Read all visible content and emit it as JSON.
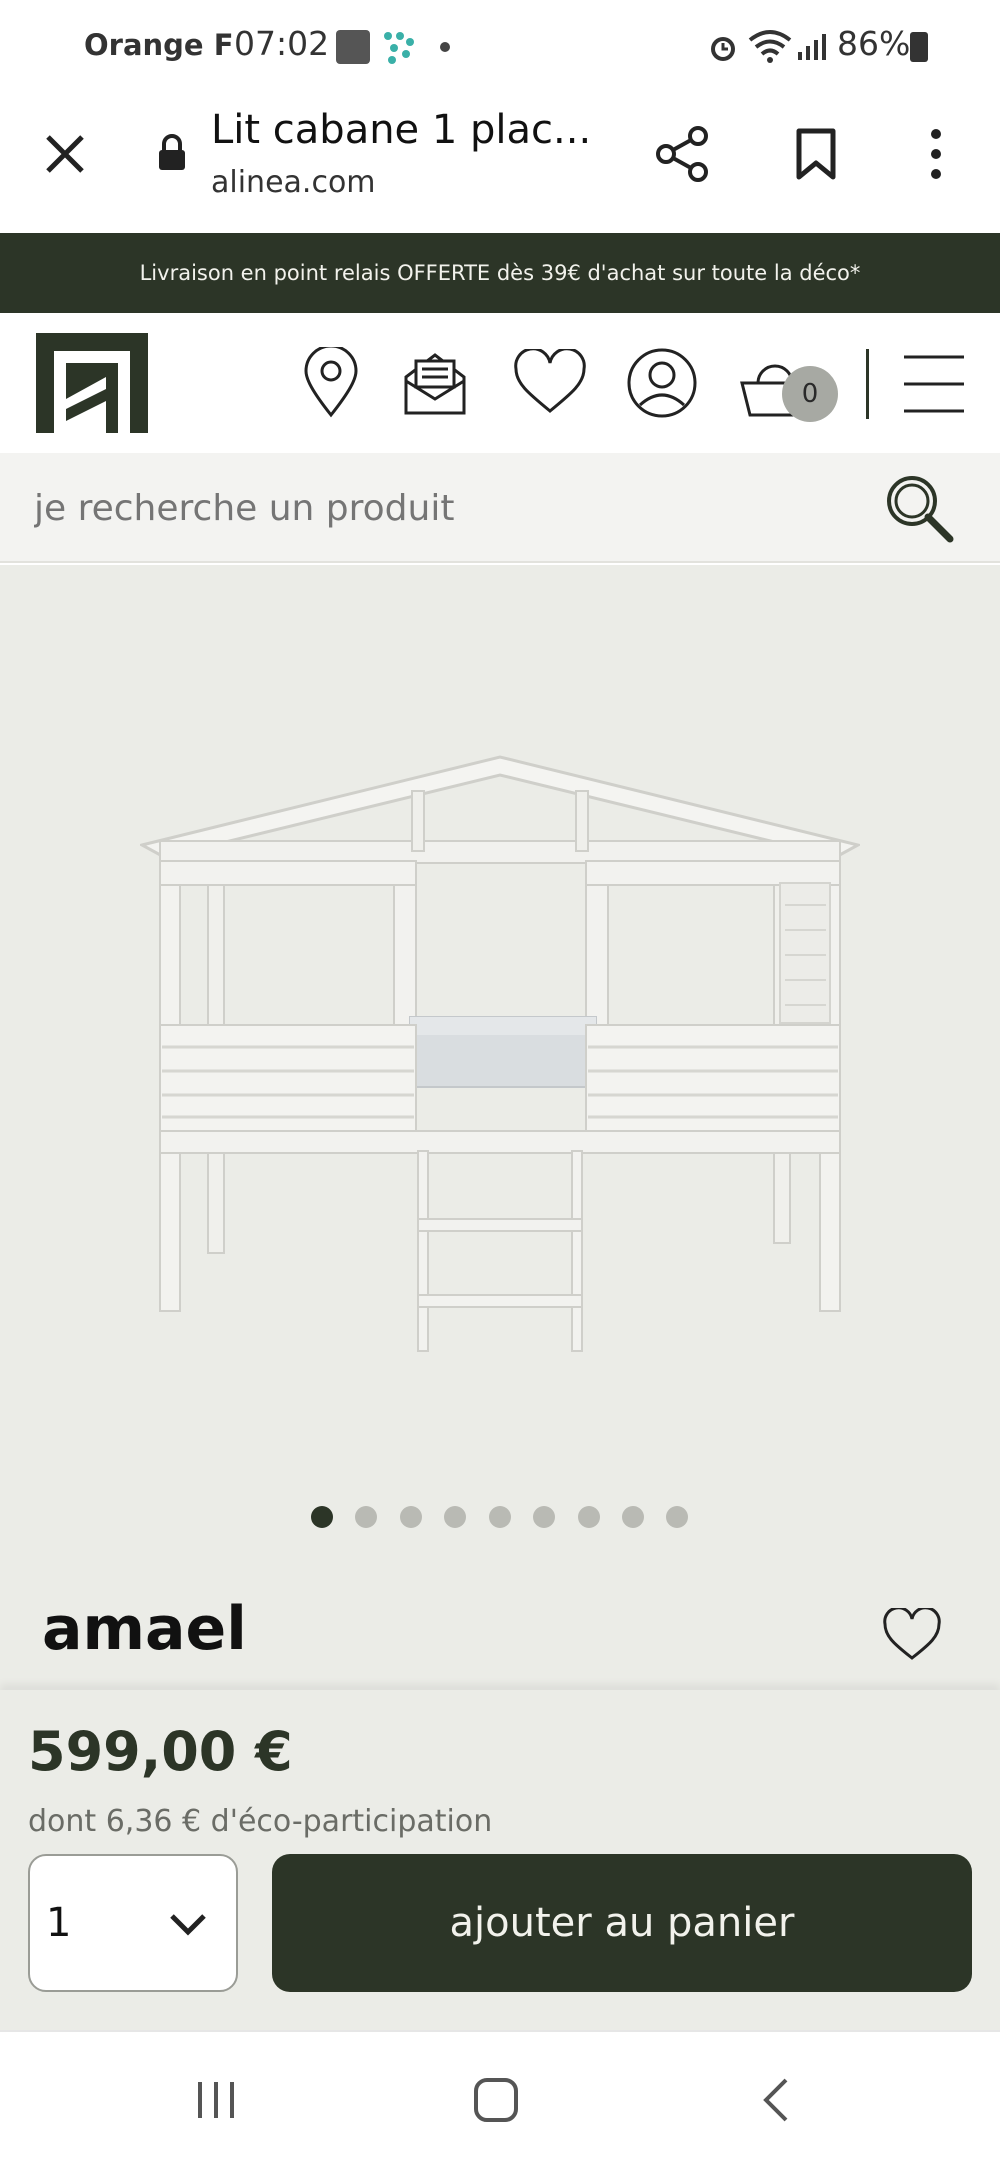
{
  "status_bar": {
    "carrier": "Orange F",
    "time": "07:02",
    "battery": "86%"
  },
  "browser": {
    "page_title": "Lit cabane 1 plac...",
    "domain": "alinea.com"
  },
  "promo_banner": {
    "text": "Livraison en point relais OFFERTE dès 39€ d'achat sur toute la déco*"
  },
  "header": {
    "cart_count": "0"
  },
  "search": {
    "placeholder": "je recherche un produit"
  },
  "gallery": {
    "image_count": 9,
    "active_index": 0
  },
  "product": {
    "name": "amael",
    "price": "599,00 €",
    "eco_participation": "dont 6,36 € d'éco-participation",
    "quantity": "1",
    "add_to_cart_label": "ajouter au panier"
  },
  "colors": {
    "brand_dark": "#2c3527",
    "panel_bg": "#ebece7",
    "search_bg": "#f3f3f1"
  }
}
